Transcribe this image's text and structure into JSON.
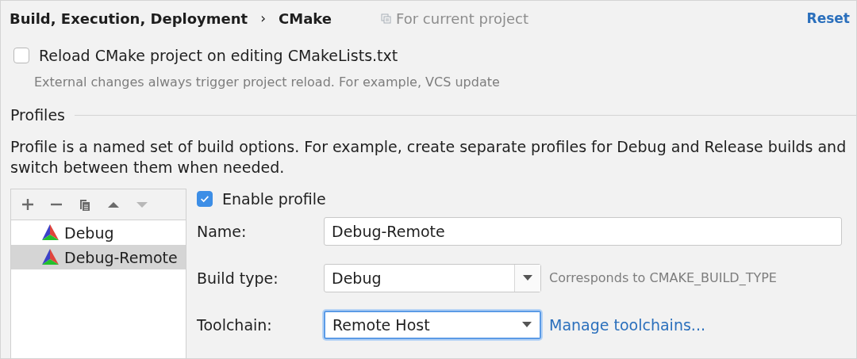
{
  "header": {
    "breadcrumb": [
      "Build, Execution, Deployment",
      "CMake"
    ],
    "separator": "›",
    "scope": "For current project",
    "reset": "Reset"
  },
  "reload_option": {
    "label": "Reload CMake project on editing CMakeLists.txt",
    "checked": false,
    "hint": "External changes always trigger project reload. For example, VCS update"
  },
  "profiles": {
    "title": "Profiles",
    "description": "Profile is a named set of build options. For example, create separate profiles for Debug and Release builds and switch between them when needed.",
    "toolbar": [
      {
        "kind": "add",
        "disabled": false
      },
      {
        "kind": "remove",
        "disabled": false
      },
      {
        "kind": "copy",
        "disabled": false
      },
      {
        "kind": "up",
        "disabled": false
      },
      {
        "kind": "down",
        "disabled": true
      }
    ],
    "items": [
      {
        "label": "Debug",
        "selected": false
      },
      {
        "label": "Debug-Remote",
        "selected": true
      }
    ],
    "enable_profile": {
      "label": "Enable profile",
      "checked": true
    },
    "fields": [
      {
        "kind": "text",
        "label": "Name:",
        "value": "Debug-Remote",
        "focused": false
      },
      {
        "kind": "combo",
        "label": "Build type:",
        "value": "Debug",
        "focused": false,
        "note": "Corresponds to CMAKE_BUILD_TYPE"
      },
      {
        "kind": "combo",
        "label": "Toolchain:",
        "value": "Remote Host",
        "focused": true,
        "link": "Manage toolchains..."
      }
    ]
  }
}
